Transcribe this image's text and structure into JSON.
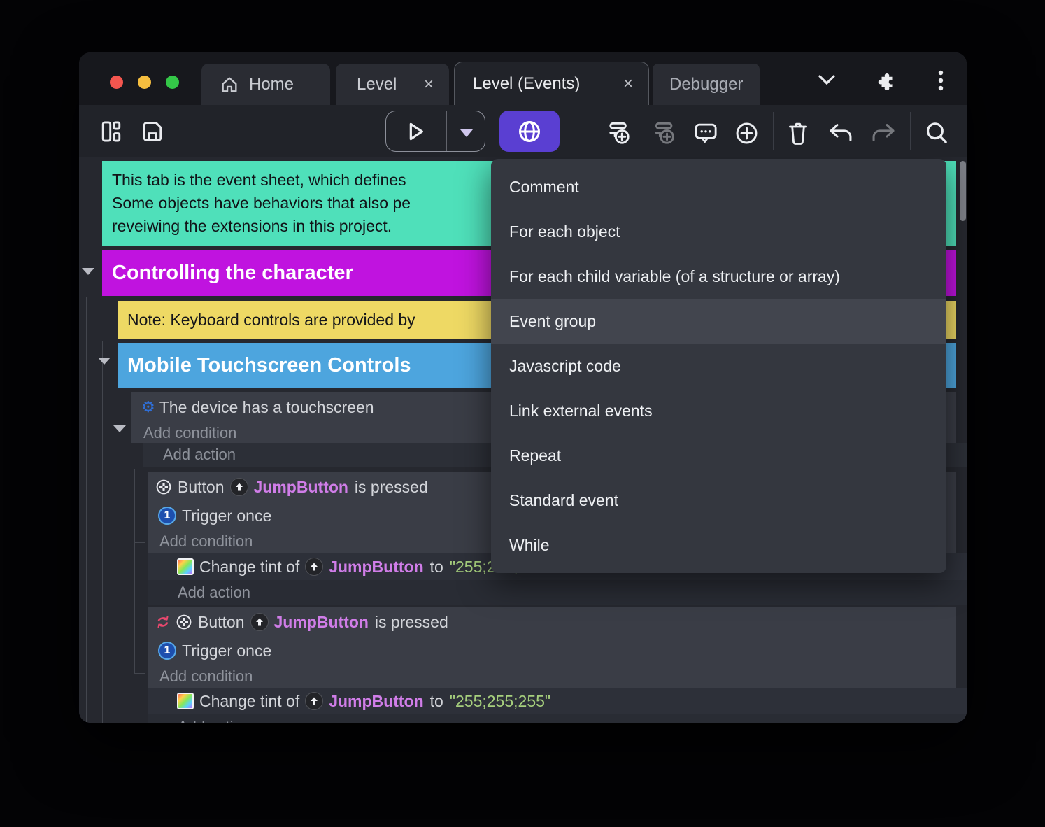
{
  "colors": {
    "accent_purple": "#5a3fd2",
    "comment_green": "#4fe0ba",
    "group_magenta": "#c013df",
    "note_yellow": "#eed964",
    "group_blue": "#4da5de",
    "object_pink": "#d07de8",
    "string_green": "#a6cf7d",
    "traffic_red": "#f4564f",
    "traffic_yellow": "#f6be3f",
    "traffic_green": "#34c748"
  },
  "tabs": {
    "home": "Home",
    "level": "Level",
    "level_events": "Level (Events)",
    "debugger": "Debugger",
    "close": "×"
  },
  "menu": {
    "highlighted_item": "Event group",
    "items": [
      "Comment",
      "For each object",
      "For each child variable (of a structure or array)",
      "Event group",
      "Javascript code",
      "Link external events",
      "Repeat",
      "Standard event",
      "While"
    ]
  },
  "sheet": {
    "comment_line1": "This tab is the event sheet, which defines",
    "comment_line2": "Some objects have behaviors that also pe",
    "comment_line3": "reveiwing the extensions in this project.",
    "group1_title": "Controlling the character",
    "note_text": "Note: Keyboard controls are provided by",
    "group2_title": "Mobile Touchscreen Controls",
    "touch_condition": "The device has a touchscreen",
    "add_condition": "Add condition",
    "add_action": "Add action",
    "button_prefix": "Button",
    "object_name": "JumpButton",
    "pressed_suffix": "is pressed",
    "trigger_once": "Trigger once",
    "trigger_badge": "1",
    "tint_prefix": "Change tint of",
    "to_word": "to",
    "tint_value": "\"255;255;255\""
  }
}
